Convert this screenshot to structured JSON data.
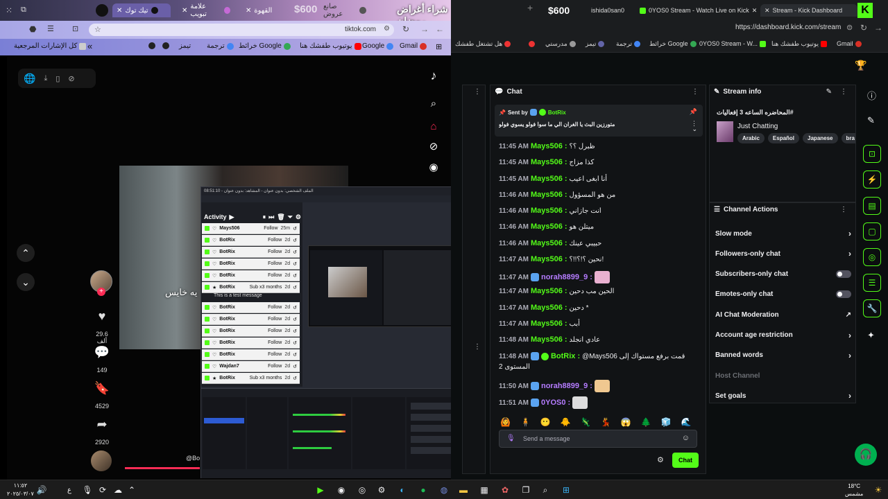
{
  "left_window": {
    "tabs": [
      {
        "label": "تيك توك",
        "active": true
      },
      {
        "label": "علامة تبويب"
      },
      {
        "label": "القهوة"
      },
      {
        "label": "صانع عروض"
      }
    ],
    "overlay_text_1": "شراء أغراض رمضان",
    "overlay_text_2": "$600",
    "address": "tiktok.com",
    "bookmarks": [
      "Gmail",
      "Google",
      "يوتيوب طفشك هنا",
      "خرائط Google",
      "ترجمة",
      "تيمز",
      "كل الإشارات المرجعية"
    ]
  },
  "tiktok": {
    "video_caption": "يه خايس",
    "likes": "29.6 ألف",
    "comments": "149",
    "saves": "4529",
    "shares": "2920",
    "handle_partial": "@Bo"
  },
  "obs": {
    "title": "الملف الشخصي: بدون عنوان - المشاهد: بدون عنوان - 08:51:10",
    "activity_title": "Activity",
    "activity": [
      {
        "name": "Mays506",
        "action": "Follow",
        "time": "25m",
        "icon": "heart"
      },
      {
        "name": "BotRix",
        "action": "Follow",
        "time": "2d",
        "icon": "heart"
      },
      {
        "name": "BotRix",
        "action": "Follow",
        "time": "2d",
        "icon": "heart"
      },
      {
        "name": "BotRix",
        "action": "Follow",
        "time": "2d",
        "icon": "heart"
      },
      {
        "name": "BotRix",
        "action": "Follow",
        "time": "2d",
        "icon": "heart"
      },
      {
        "name": "BotRix",
        "action": "Sub x3 months",
        "time": "2d",
        "icon": "star",
        "sub": "This is a test message"
      },
      {
        "name": "BotRix",
        "action": "Follow",
        "time": "2d",
        "icon": "heart"
      },
      {
        "name": "BotRix",
        "action": "Follow",
        "time": "2d",
        "icon": "heart"
      },
      {
        "name": "BotRix",
        "action": "Follow",
        "time": "2d",
        "icon": "heart"
      },
      {
        "name": "BotRix",
        "action": "Follow",
        "time": "2d",
        "icon": "heart"
      },
      {
        "name": "BotRix",
        "action": "Follow",
        "time": "2d",
        "icon": "heart"
      },
      {
        "name": "Wajdan7",
        "action": "Follow",
        "time": "2d",
        "icon": "heart"
      },
      {
        "name": "BotRix",
        "action": "Sub x3 months",
        "time": "2d",
        "icon": "star"
      }
    ]
  },
  "right_window": {
    "tabs": [
      {
        "label": "$600"
      },
      {
        "label": "ishida0san0"
      },
      {
        "label": "0YOS0 Stream - Watch Live on Kick"
      },
      {
        "label": "Stream - Kick Dashboard",
        "active": true
      }
    ],
    "address": "https://dashboard.kick.com/stream",
    "bookmarks": [
      "هل تشتغل طفشك",
      "مدرستي",
      "تيمز",
      "ترجمة",
      "خرائط Google",
      "0YOS0 Stream - W...",
      "يوتيوب طفشك هنا",
      "Gmail"
    ]
  },
  "chat": {
    "title": "Chat",
    "pinned": {
      "sent_by_label": "Sent by",
      "sender": "BotRix",
      "text": "متورزين البث يا الغران الي ما سوا فولو يسوي فولو"
    },
    "messages": [
      {
        "time": "11:45 AM",
        "user": "Mays506",
        "text": "ظبرل ؟؟",
        "color": "#53fc18"
      },
      {
        "time": "11:45 AM",
        "user": "Mays506",
        "text": "كذا مزاج",
        "color": "#53fc18"
      },
      {
        "time": "11:45 AM",
        "user": "Mays506",
        "text": "أنا ابغى اعيب",
        "color": "#53fc18"
      },
      {
        "time": "11:46 AM",
        "user": "Mays506",
        "text": "من هو المسؤول",
        "color": "#53fc18"
      },
      {
        "time": "11:46 AM",
        "user": "Mays506",
        "text": "انت جازاني",
        "color": "#53fc18"
      },
      {
        "time": "11:46 AM",
        "user": "Mays506",
        "text": "ميتلن هو",
        "color": "#53fc18"
      },
      {
        "time": "11:46 AM",
        "user": "Mays506",
        "text": "حبيبي عينك",
        "color": "#53fc18"
      },
      {
        "time": "11:47 AM",
        "user": "Mays506",
        "text": "نحين ؟!؟!!؟!",
        "color": "#53fc18"
      },
      {
        "time": "11:47 AM",
        "user": "norah8899_9",
        "text": "",
        "color": "#b57cff",
        "badge": true,
        "emote": "#e9b0d0"
      },
      {
        "time": "11:47 AM",
        "user": "Mays506",
        "text": "الحين مب دحين",
        "color": "#53fc18"
      },
      {
        "time": "11:47 AM",
        "user": "Mays506",
        "text": "دحين *",
        "color": "#53fc18"
      },
      {
        "time": "11:47 AM",
        "user": "Mays506",
        "text": "أبب",
        "color": "#53fc18"
      },
      {
        "time": "11:48 AM",
        "user": "Mays506",
        "text": "عادي انجلد",
        "color": "#53fc18"
      },
      {
        "time": "11:48 AM",
        "user": "BotRix",
        "text": "@Mays506 قمت برفع مستواك إلى",
        "text2": "المستوى 2",
        "color": "#53fc18",
        "badge": true,
        "verified": true
      },
      {
        "time": "11:50 AM",
        "user": "norah8899_9",
        "text": "",
        "color": "#b57cff",
        "badge": true,
        "emote": "#f0c890"
      },
      {
        "time": "11:51 AM",
        "user": "0YOS0",
        "text": "",
        "color": "#b57cff",
        "badge": true,
        "emote": "#dddddd"
      }
    ],
    "input_placeholder": "Send a message",
    "send_label": "Chat"
  },
  "stream_info": {
    "title": "Stream info",
    "stream_title": "المحاضره الساعه 3 إفعاليات#",
    "category": "Just Chatting",
    "tags": [
      "Arabic",
      "Español",
      "Japanese",
      "bra"
    ]
  },
  "channel_actions": {
    "title": "Channel Actions",
    "items": [
      {
        "label": "Slow mode",
        "control": "chevron"
      },
      {
        "label": "Followers-only chat",
        "control": "chevron"
      },
      {
        "label": "Subscribers-only chat",
        "control": "toggle"
      },
      {
        "label": "Emotes-only chat",
        "control": "toggle"
      },
      {
        "label": "AI Chat Moderation",
        "control": "external"
      },
      {
        "label": "Account age restriction",
        "control": "chevron"
      },
      {
        "label": "Banned words",
        "control": "chevron"
      },
      {
        "label": "Host Channel",
        "control": "none",
        "muted": true
      },
      {
        "label": "Set goals",
        "control": "chevron"
      }
    ]
  },
  "taskbar": {
    "time": "١١:٥٢",
    "date": "٢٠٢٥/٠٣/٠٧",
    "weather_temp": "18°C",
    "weather_desc": "مشمس",
    "lang": "ع"
  },
  "colors": {
    "kick_green": "#53fc18",
    "chat_bg": "#111315",
    "obs_bg": "#272a33"
  }
}
